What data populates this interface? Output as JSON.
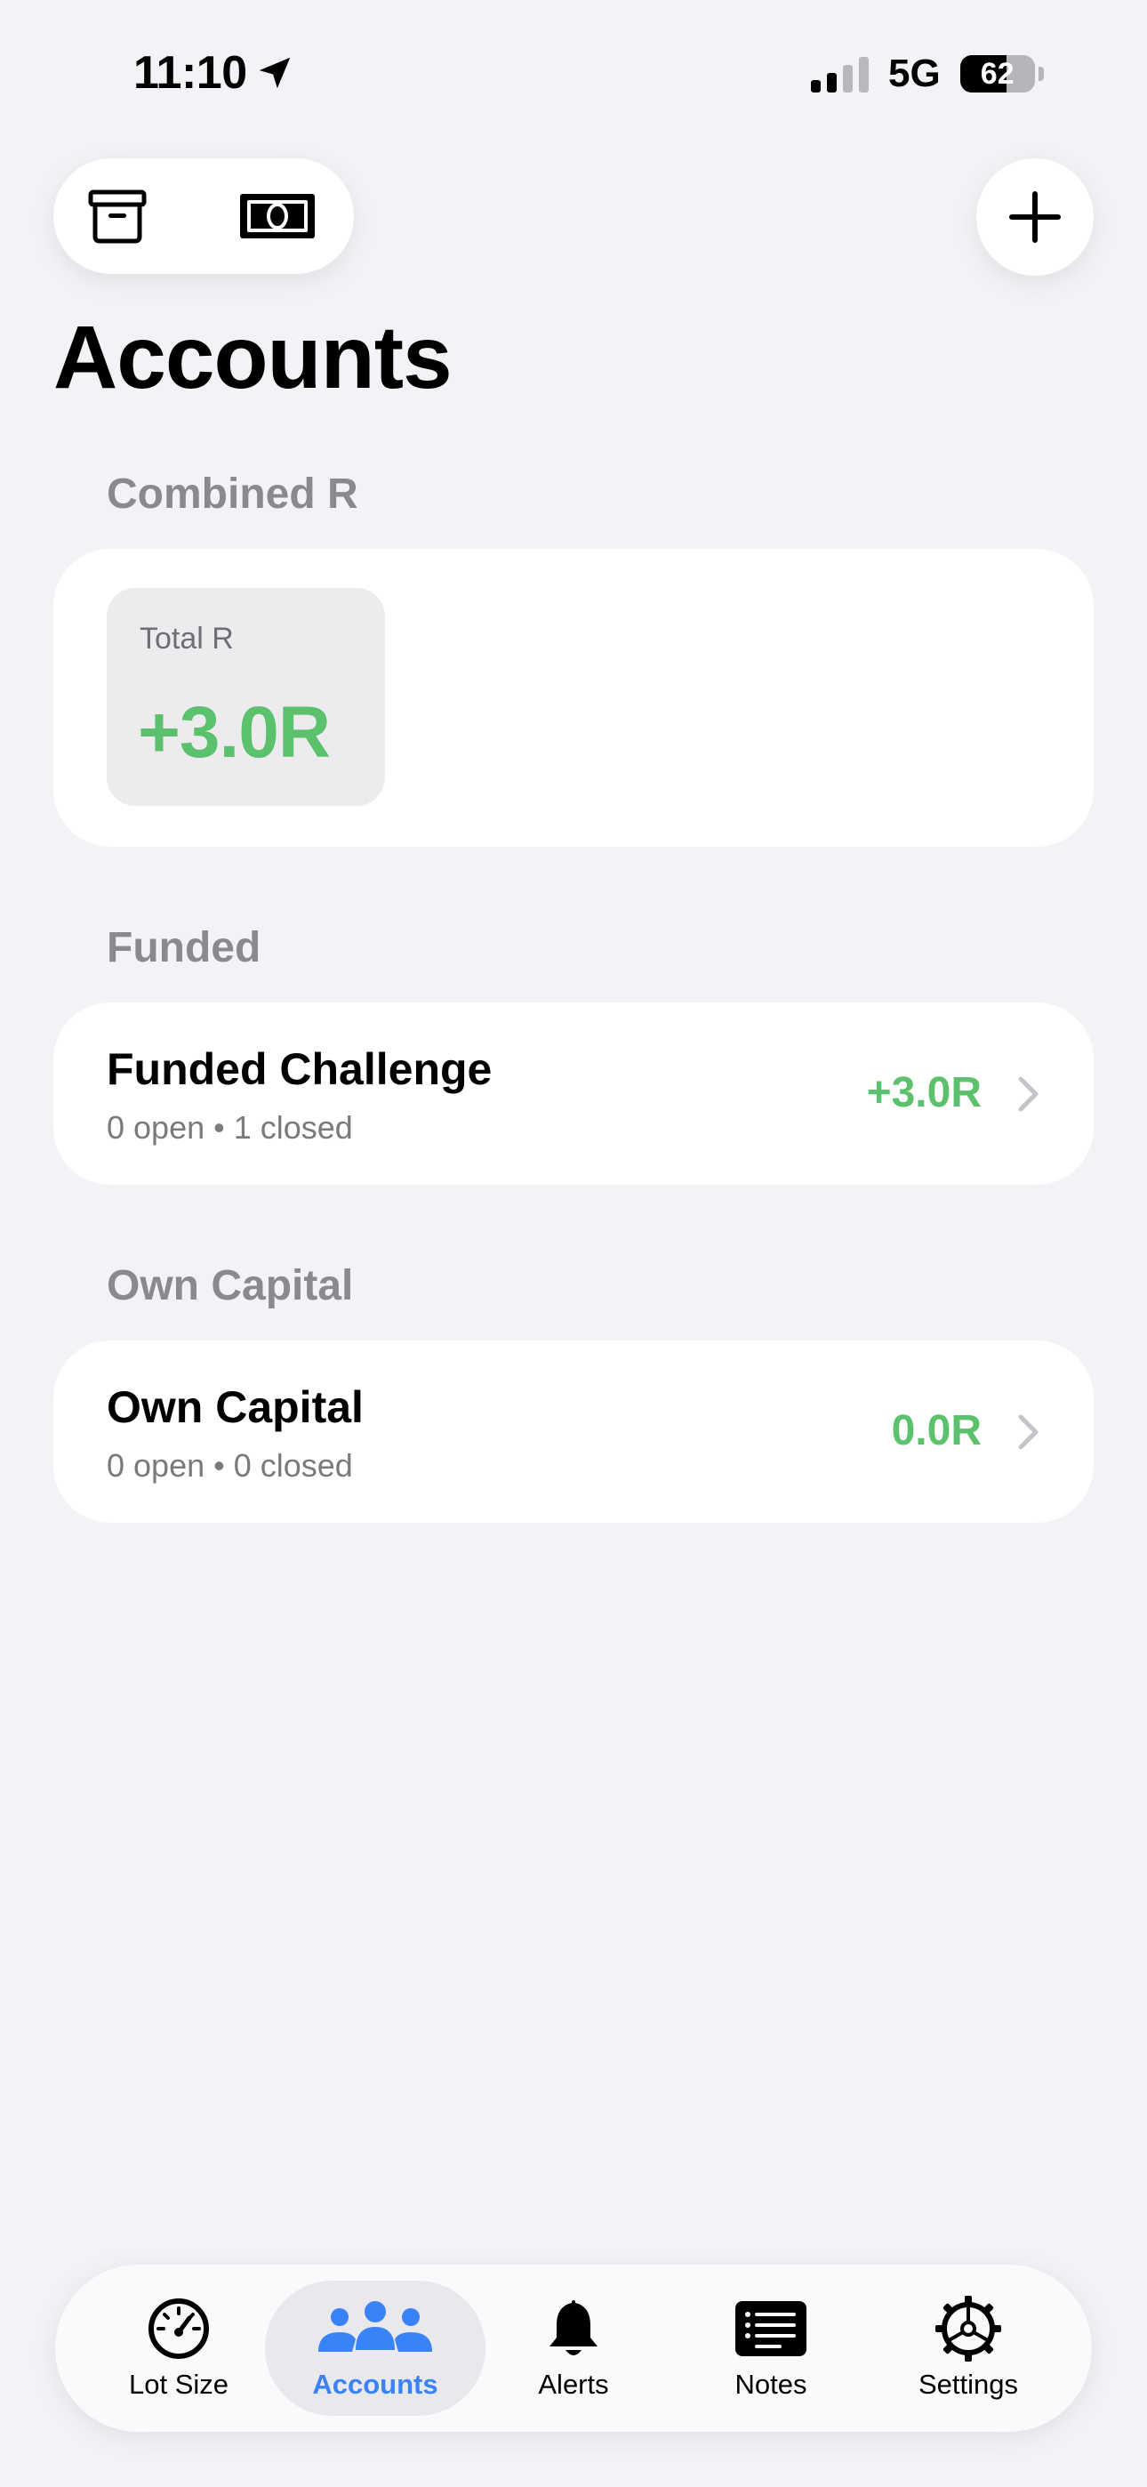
{
  "status_bar": {
    "time": "11:10",
    "network": "5G",
    "battery": "62",
    "battery_level": 0.62
  },
  "toolbar": {
    "left_icons": [
      "archive-icon",
      "cash-icon"
    ],
    "add_icon": "plus-icon"
  },
  "page": {
    "title": "Accounts"
  },
  "combined": {
    "header": "Combined R",
    "total_label": "Total R",
    "total_value": "+3.0R"
  },
  "sections": [
    {
      "header": "Funded",
      "account": {
        "name": "Funded Challenge",
        "summary": "0 open • 1 closed",
        "value": "+3.0R"
      }
    },
    {
      "header": "Own Capital",
      "account": {
        "name": "Own Capital",
        "summary": "0 open • 0 closed",
        "value": "0.0R"
      }
    }
  ],
  "tabbar": {
    "items": [
      {
        "label": "Lot Size",
        "icon": "gauge-icon"
      },
      {
        "label": "Accounts",
        "icon": "people-icon"
      },
      {
        "label": "Alerts",
        "icon": "bell-icon"
      },
      {
        "label": "Notes",
        "icon": "notes-icon"
      },
      {
        "label": "Settings",
        "icon": "gear-icon"
      }
    ],
    "active": "Accounts"
  },
  "colors": {
    "positive": "#5cc16d",
    "accent": "#3a82f7",
    "background": "#f2f2f7",
    "secondary_text": "#8a8a8e"
  }
}
